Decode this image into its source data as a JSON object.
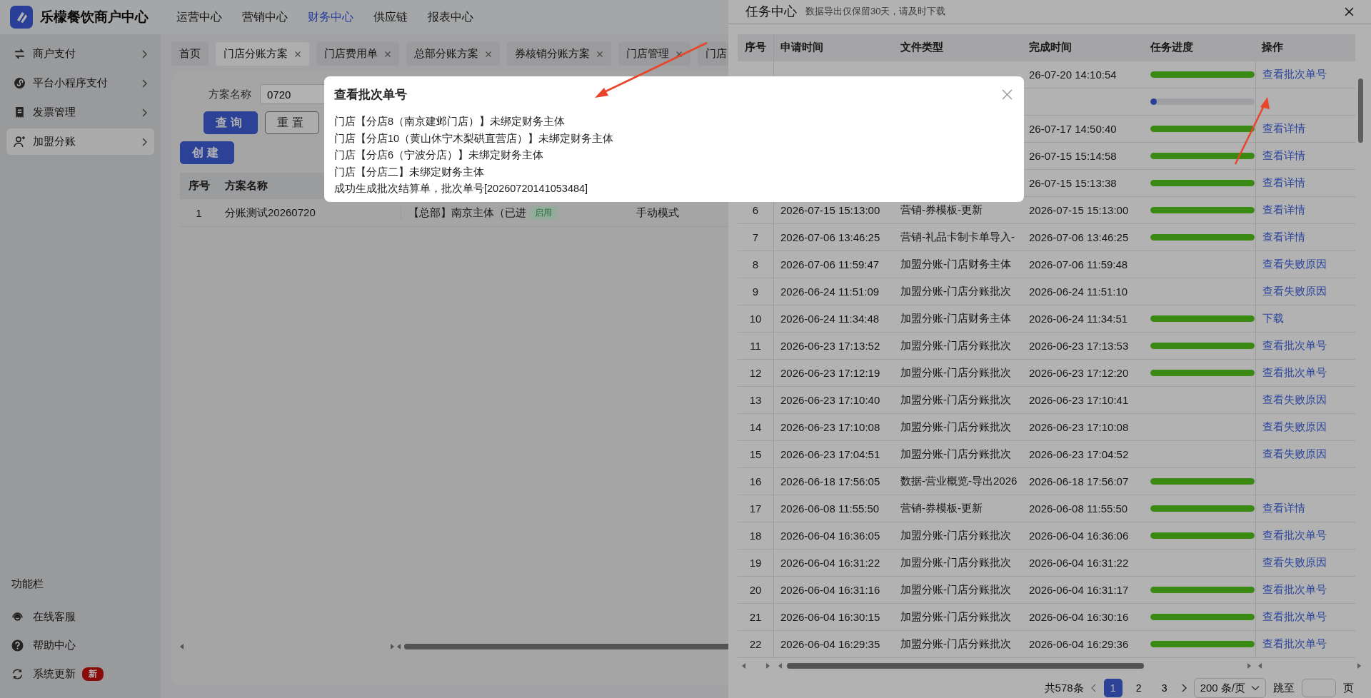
{
  "app": {
    "title": "乐檬餐饮商户中心"
  },
  "top_nav": [
    {
      "label": "运营中心",
      "selected": false
    },
    {
      "label": "营销中心",
      "selected": false
    },
    {
      "label": "财务中心",
      "selected": true
    },
    {
      "label": "供应链",
      "selected": false
    },
    {
      "label": "报表中心",
      "selected": false
    }
  ],
  "sidebar": {
    "items": [
      {
        "label": "商户支付",
        "selected": false
      },
      {
        "label": "平台小程序支付",
        "selected": false
      },
      {
        "label": "发票管理",
        "selected": false
      },
      {
        "label": "加盟分账",
        "selected": true
      }
    ],
    "footer_title": "功能栏",
    "footer_items": [
      {
        "label": "在线客服"
      },
      {
        "label": "帮助中心"
      },
      {
        "label": "系统更新",
        "badge": "新"
      }
    ]
  },
  "page_tabs": [
    {
      "label": "首页",
      "selected": false,
      "closable": false
    },
    {
      "label": "门店分账方案",
      "selected": true,
      "closable": true
    },
    {
      "label": "门店费用单",
      "selected": false,
      "closable": true
    },
    {
      "label": "总部分账方案",
      "selected": false,
      "closable": true
    },
    {
      "label": "券核销分账方案",
      "selected": false,
      "closable": true
    },
    {
      "label": "门店管理",
      "selected": false,
      "closable": true
    },
    {
      "label": "门店",
      "selected": false,
      "closable": false
    }
  ],
  "filter": {
    "label": "方案名称",
    "value": "0720",
    "search_button": "查询",
    "reset_button": "重置"
  },
  "create_button": "创建",
  "plan_table": {
    "columns": [
      "序号",
      "方案名称"
    ],
    "rows": [
      {
        "index": "1",
        "name": "分账测试20260720",
        "subject": "【总部】南京主体（已进",
        "status": "启用",
        "mode": "手动模式"
      }
    ]
  },
  "dialog": {
    "title": "查看批次单号",
    "lines": [
      "门店【分店8（南京建邺门店）】未绑定财务主体",
      "门店【分店10（黄山休宁木梨硔直营店）】未绑定财务主体",
      "门店【分店6（宁波分店）】未绑定财务主体",
      "门店【分店二】未绑定财务主体",
      "成功生成批次结算单，批次单号[20260720141053484]"
    ]
  },
  "task_drawer": {
    "title": "任务中心",
    "subtitle": "数据导出仅保留30天，请及时下载",
    "columns": [
      "序号",
      "申请时间",
      "文件类型",
      "完成时间",
      "任务进度",
      "操作"
    ],
    "rows": [
      {
        "complete_time": "26-07-20 14:10:54",
        "progress": {
          "level": 1
        },
        "action": "查看批次单号"
      },
      {
        "progress": {
          "level": 0.06
        }
      },
      {
        "complete_time": "26-07-17 14:50:40",
        "progress": {
          "level": 1
        },
        "action": "查看详情"
      },
      {
        "complete_time": "26-07-15 15:14:58",
        "progress": {
          "level": 1
        },
        "action": "查看详情"
      },
      {
        "complete_time": "26-07-15 15:13:38",
        "progress": {
          "level": 1
        },
        "action": "查看详情"
      },
      {
        "index": "6",
        "request_time": "2026-07-15 15:13:00",
        "file_type": "营销-券模板-更新",
        "complete_time": "2026-07-15 15:13:00",
        "progress": {
          "level": 1
        },
        "action": "查看详情"
      },
      {
        "index": "7",
        "request_time": "2026-07-06 13:46:25",
        "file_type": "营销-礼品卡制卡单导入-",
        "complete_time": "2026-07-06 13:46:25",
        "progress": {
          "level": 1
        },
        "action": "查看详情"
      },
      {
        "index": "8",
        "request_time": "2026-07-06 11:59:47",
        "file_type": "加盟分账-门店财务主体",
        "complete_time": "2026-07-06 11:59:48",
        "action": "查看失败原因"
      },
      {
        "index": "9",
        "request_time": "2026-06-24 11:51:09",
        "file_type": "加盟分账-门店分账批次",
        "complete_time": "2026-06-24 11:51:10",
        "action": "查看失败原因"
      },
      {
        "index": "10",
        "request_time": "2026-06-24 11:34:48",
        "file_type": "加盟分账-门店财务主体",
        "complete_time": "2026-06-24 11:34:51",
        "progress": {
          "level": 1
        },
        "action": "下载"
      },
      {
        "index": "11",
        "request_time": "2026-06-23 17:13:52",
        "file_type": "加盟分账-门店分账批次",
        "complete_time": "2026-06-23 17:13:53",
        "progress": {
          "level": 1
        },
        "action": "查看批次单号"
      },
      {
        "index": "12",
        "request_time": "2026-06-23 17:12:19",
        "file_type": "加盟分账-门店分账批次",
        "complete_time": "2026-06-23 17:12:20",
        "progress": {
          "level": 1
        },
        "action": "查看批次单号"
      },
      {
        "index": "13",
        "request_time": "2026-06-23 17:10:40",
        "file_type": "加盟分账-门店分账批次",
        "complete_time": "2026-06-23 17:10:41",
        "action": "查看失败原因"
      },
      {
        "index": "14",
        "request_time": "2026-06-23 17:10:08",
        "file_type": "加盟分账-门店分账批次",
        "complete_time": "2026-06-23 17:10:08",
        "action": "查看失败原因"
      },
      {
        "index": "15",
        "request_time": "2026-06-23 17:04:51",
        "file_type": "加盟分账-门店分账批次",
        "complete_time": "2026-06-23 17:04:52",
        "action": "查看失败原因"
      },
      {
        "index": "16",
        "request_time": "2026-06-18 17:56:05",
        "file_type": "数据-营业概览-导出2026",
        "complete_time": "2026-06-18 17:56:07",
        "progress": {
          "level": 1
        }
      },
      {
        "index": "17",
        "request_time": "2026-06-08 11:55:50",
        "file_type": "营销-券模板-更新",
        "complete_time": "2026-06-08 11:55:50",
        "progress": {
          "level": 1
        },
        "action": "查看详情"
      },
      {
        "index": "18",
        "request_time": "2026-06-04 16:36:05",
        "file_type": "加盟分账-门店分账批次",
        "complete_time": "2026-06-04 16:36:06",
        "progress": {
          "level": 1
        },
        "action": "查看批次单号"
      },
      {
        "index": "19",
        "request_time": "2026-06-04 16:31:22",
        "file_type": "加盟分账-门店分账批次",
        "complete_time": "2026-06-04 16:31:22",
        "action": "查看失败原因"
      },
      {
        "index": "20",
        "request_time": "2026-06-04 16:31:16",
        "file_type": "加盟分账-门店分账批次",
        "complete_time": "2026-06-04 16:31:17",
        "progress": {
          "level": 1
        },
        "action": "查看批次单号"
      },
      {
        "index": "21",
        "request_time": "2026-06-04 16:30:15",
        "file_type": "加盟分账-门店分账批次",
        "complete_time": "2026-06-04 16:30:16",
        "progress": {
          "level": 1
        },
        "action": "查看批次单号"
      },
      {
        "index": "22",
        "request_time": "2026-06-04 16:29:35",
        "file_type": "加盟分账-门店分账批次",
        "complete_time": "2026-06-04 16:29:36",
        "progress": {
          "level": 1
        },
        "action": "查看批次单号"
      }
    ],
    "pagination": {
      "total": "共578条",
      "pages": [
        {
          "label": "1",
          "selected": true
        },
        {
          "label": "2",
          "selected": false
        },
        {
          "label": "3",
          "selected": false
        }
      ],
      "page_size": "200 条/页",
      "jump_label": "跳至",
      "page_unit": "页"
    }
  }
}
